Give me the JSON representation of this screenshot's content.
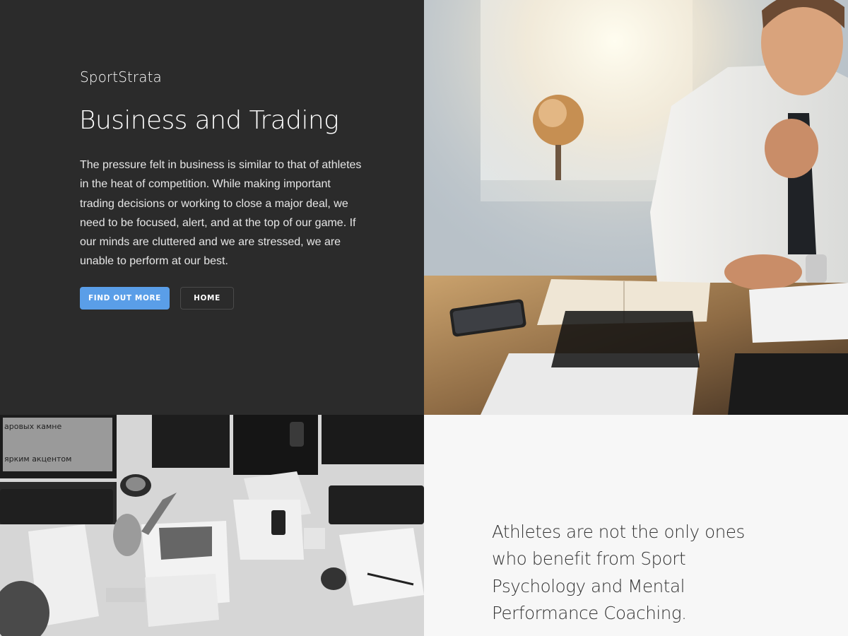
{
  "brand": {
    "name": "SportStrata"
  },
  "hero": {
    "title": "Business and Trading",
    "body": "The pressure felt in business is similar to that of athletes in the heat of competition. While making important trading decisions or working to close a major deal, we need to be focused, alert, and at the top of our game. If our minds are cluttered and we are stressed, we are unable to perform at our best.",
    "primary_button": "FIND OUT MORE",
    "secondary_button": "HOME"
  },
  "desk_photo": {
    "monitor_text_line1": "аровых камне",
    "monitor_text_line2": "ярким акцентом"
  },
  "quote": {
    "text": "Athletes are not the only ones who benefit from Sport Psychology and Mental Performance Coaching."
  },
  "colors": {
    "dark_panel": "#2b2b2b",
    "accent": "#5a9ee8",
    "light_panel": "#f7f7f7"
  }
}
